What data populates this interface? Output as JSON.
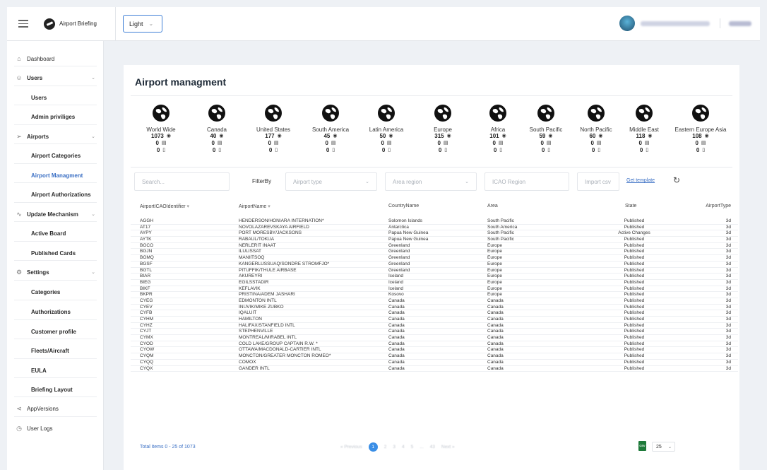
{
  "app": {
    "brand": "Airport Briefing",
    "theme_value": "Light",
    "user": {
      "email": "b•••••@•••••••.com",
      "name": "Nam"
    }
  },
  "sidebar": {
    "items": [
      {
        "label": "Dashboard",
        "icon": "home-icon"
      },
      {
        "label": "Users",
        "icon": "users-icon"
      },
      {
        "label": "Users"
      },
      {
        "label": "Admin priviliges"
      },
      {
        "label": "Airports",
        "icon": "plane-icon"
      },
      {
        "label": "Airport Categories"
      },
      {
        "label": "Airport Managment"
      },
      {
        "label": "Airport Authorizations"
      },
      {
        "label": "Update Mechanism",
        "icon": "pulse-icon"
      },
      {
        "label": "Active Board"
      },
      {
        "label": "Published Cards"
      },
      {
        "label": "Settings",
        "icon": "gear-icon"
      },
      {
        "label": "Categories"
      },
      {
        "label": "Authorizations"
      },
      {
        "label": "Customer profile"
      },
      {
        "label": "Fleets/Aircraft"
      },
      {
        "label": "EULA"
      },
      {
        "label": "Briefing Layout"
      },
      {
        "label": "AppVersions",
        "icon": "share-icon"
      },
      {
        "label": "User Logs",
        "icon": "clock-icon"
      }
    ]
  },
  "main": {
    "title": "Airport managment",
    "regions": [
      {
        "name": "World Wide",
        "count": "1073",
        "a": "0",
        "b": "0"
      },
      {
        "name": "Canada",
        "count": "40",
        "a": "0",
        "b": "0"
      },
      {
        "name": "United States",
        "count": "177",
        "a": "0",
        "b": "0"
      },
      {
        "name": "South America",
        "count": "45",
        "a": "0",
        "b": "0"
      },
      {
        "name": "Latin America",
        "count": "50",
        "a": "0",
        "b": "0"
      },
      {
        "name": "Europe",
        "count": "315",
        "a": "0",
        "b": "0"
      },
      {
        "name": "Africa",
        "count": "101",
        "a": "0",
        "b": "0"
      },
      {
        "name": "South Pacific",
        "count": "59",
        "a": "0",
        "b": "0"
      },
      {
        "name": "North Pacific",
        "count": "60",
        "a": "0",
        "b": "0"
      },
      {
        "name": "Middle East",
        "count": "118",
        "a": "0",
        "b": "0"
      },
      {
        "name": "Eastern Europe Asia",
        "count": "108",
        "a": "0",
        "b": "0"
      }
    ],
    "filters": {
      "search_placeholder": "Search...",
      "filter_by_label": "FilterBy",
      "airport_type_placeholder": "Airport type",
      "area_region_placeholder": "Area region",
      "icao_region_placeholder": "ICAO Region",
      "import_csv_placeholder": "Import csv",
      "get_template_label": "Get template"
    },
    "table": {
      "headers": {
        "icao": "AirportICAOIdentifier",
        "name": "AirportName",
        "country": "CountryName",
        "area": "Area",
        "state": "State",
        "type": "AirportType"
      },
      "rows": [
        [
          "AGGH",
          "HENDERSON/HONIARA INTERNATION*",
          "Solomon Islands",
          "South Pacific",
          "Published",
          "3d"
        ],
        [
          "AT17",
          "NOVOLAZAREVSKAYA AIRFIELD",
          "Antarctica",
          "South America",
          "Published",
          "3d"
        ],
        [
          "AYPY",
          "PORT MORESBY/JACKSONS",
          "Papua New Guinea",
          "South Pacific",
          "Active Changes",
          "3d"
        ],
        [
          "AYTK",
          "RABAUL/TOKUA",
          "Papua New Guinea",
          "South Pacific",
          "Published",
          "3d"
        ],
        [
          "BGCO",
          "NERLERIT INAAT",
          "Greenland",
          "Europe",
          "Published",
          "3d"
        ],
        [
          "BGJN",
          "ILULISSAT",
          "Greenland",
          "Europe",
          "Published",
          "3d"
        ],
        [
          "BGMQ",
          "MANIITSOQ",
          "Greenland",
          "Europe",
          "Published",
          "3d"
        ],
        [
          "BGSF",
          "KANGERLUSSUAQ/SONDRE STROMFJO*",
          "Greenland",
          "Europe",
          "Published",
          "3d"
        ],
        [
          "BGTL",
          "PITUFFIK/THULE AIRBASE",
          "Greenland",
          "Europe",
          "Published",
          "3d"
        ],
        [
          "BIAR",
          "AKUREYRI",
          "Iceland",
          "Europe",
          "Published",
          "3d"
        ],
        [
          "BIEG",
          "EGILSSTADIR",
          "Iceland",
          "Europe",
          "Published",
          "3d"
        ],
        [
          "BIKF",
          "KEFLAVIK",
          "Iceland",
          "Europe",
          "Published",
          "3d"
        ],
        [
          "BKPR",
          "PRISTINA/ADEM JASHARI",
          "Kosovo",
          "Europe",
          "Published",
          "3d"
        ],
        [
          "CYEG",
          "EDMONTON INTL",
          "Canada",
          "Canada",
          "Published",
          "3d"
        ],
        [
          "CYEV",
          "INUVIK/MIKE ZUBKO",
          "Canada",
          "Canada",
          "Published",
          "3d"
        ],
        [
          "CYFB",
          "IQALUIT",
          "Canada",
          "Canada",
          "Published",
          "3d"
        ],
        [
          "CYHM",
          "HAMILTON",
          "Canada",
          "Canada",
          "Published",
          "3d"
        ],
        [
          "CYHZ",
          "HALIFAX/STANFIELD INTL",
          "Canada",
          "Canada",
          "Published",
          "3d"
        ],
        [
          "CYJT",
          "STEPHENVILLE",
          "Canada",
          "Canada",
          "Published",
          "3d"
        ],
        [
          "CYMX",
          "MONTREAL/MIRABEL INTL",
          "Canada",
          "Canada",
          "Published",
          "3d"
        ],
        [
          "CYOD",
          "COLD LAKE/GROUP CAPTAIN R.W. *",
          "Canada",
          "Canada",
          "Published",
          "3d"
        ],
        [
          "CYOW",
          "OTTAWA/MACDONALD-CARTIER INTL",
          "Canada",
          "Canada",
          "Published",
          "3d"
        ],
        [
          "CYQM",
          "MONCTON/GREATER MONCTON ROMEO*",
          "Canada",
          "Canada",
          "Published",
          "3d"
        ],
        [
          "CYQQ",
          "COMOX",
          "Canada",
          "Canada",
          "Published",
          "3d"
        ],
        [
          "CYQX",
          "GANDER INTL",
          "Canada",
          "Canada",
          "Published",
          "3d"
        ]
      ]
    },
    "footer": {
      "total": "Total items 0 - 25 of 1073",
      "pager": {
        "prev": "« Previous",
        "pages": [
          "1",
          "2",
          "3",
          "4",
          "5",
          "...",
          "43"
        ],
        "next": "Next »"
      },
      "csv_icon": "CSV",
      "page_size": "25"
    }
  }
}
